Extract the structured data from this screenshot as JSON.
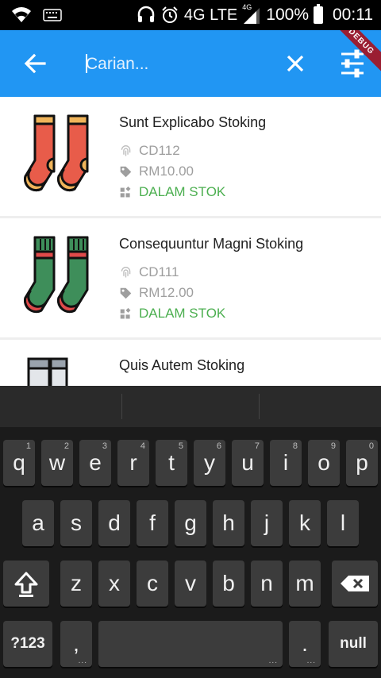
{
  "status": {
    "network": "4G LTE",
    "network_small": "4G",
    "battery": "100%",
    "time": "00:11"
  },
  "appbar": {
    "placeholder": "Carian...",
    "debug": "DEBUG",
    "back_icon": "arrow-left-icon",
    "clear_icon": "close-icon",
    "filter_icon": "tune-icon",
    "color": "#2196F3"
  },
  "products": [
    {
      "name": "Sunt Explicabo Stoking",
      "code": "CD112",
      "price": "RM10.00",
      "stock": "DALAM STOK",
      "image": "sock-red-icon"
    },
    {
      "name": "Consequuntur Magni Stoking",
      "code": "CD111",
      "price": "RM12.00",
      "stock": "DALAM STOK",
      "image": "sock-green-icon"
    },
    {
      "name": "Quis Autem Stoking",
      "image": "sock-grey-icon"
    }
  ],
  "keyboard": {
    "row1": [
      {
        "k": "q",
        "a": "1"
      },
      {
        "k": "w",
        "a": "2"
      },
      {
        "k": "e",
        "a": "3"
      },
      {
        "k": "r",
        "a": "4"
      },
      {
        "k": "t",
        "a": "5"
      },
      {
        "k": "y",
        "a": "6"
      },
      {
        "k": "u",
        "a": "7"
      },
      {
        "k": "i",
        "a": "8"
      },
      {
        "k": "o",
        "a": "9"
      },
      {
        "k": "p",
        "a": "0"
      }
    ],
    "row2": [
      "a",
      "s",
      "d",
      "f",
      "g",
      "h",
      "j",
      "k",
      "l"
    ],
    "row3": [
      "z",
      "x",
      "c",
      "v",
      "b",
      "n",
      "m"
    ],
    "numbers_label": "?123",
    "comma": ",",
    "period": ".",
    "action_label": "null"
  }
}
